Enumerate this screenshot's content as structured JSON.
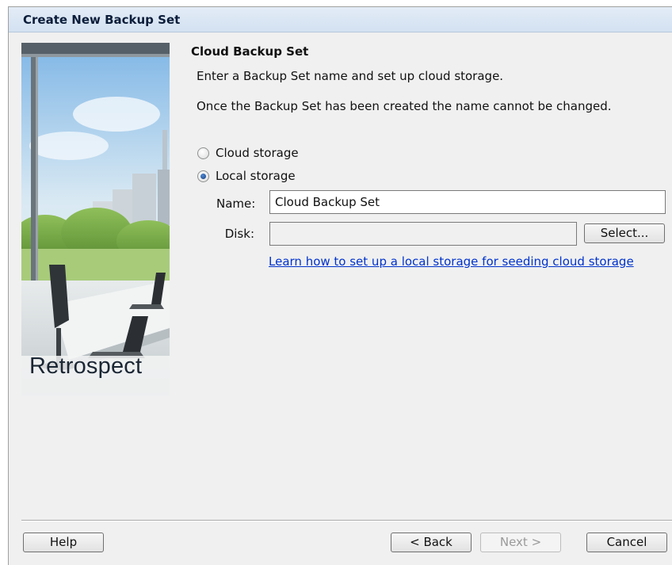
{
  "window": {
    "title": "Create New Backup Set"
  },
  "banner": {
    "brand_text": "Retrospect"
  },
  "content": {
    "heading": "Cloud Backup Set",
    "description_1": "Enter a Backup Set name and set up cloud storage.",
    "description_2": "Once the Backup Set has been created the name cannot be changed.",
    "storage_options": [
      {
        "label": "Cloud storage",
        "selected": false
      },
      {
        "label": "Local storage",
        "selected": true
      }
    ],
    "name_label": "Name:",
    "name_value": "Cloud Backup Set",
    "disk_label": "Disk:",
    "disk_value": "",
    "select_button": "Select...",
    "help_link": "Learn how to set up a local storage for seeding cloud storage"
  },
  "footer": {
    "help_button": "Help",
    "back_button": "< Back",
    "next_button": "Next >",
    "cancel_button": "Cancel"
  }
}
